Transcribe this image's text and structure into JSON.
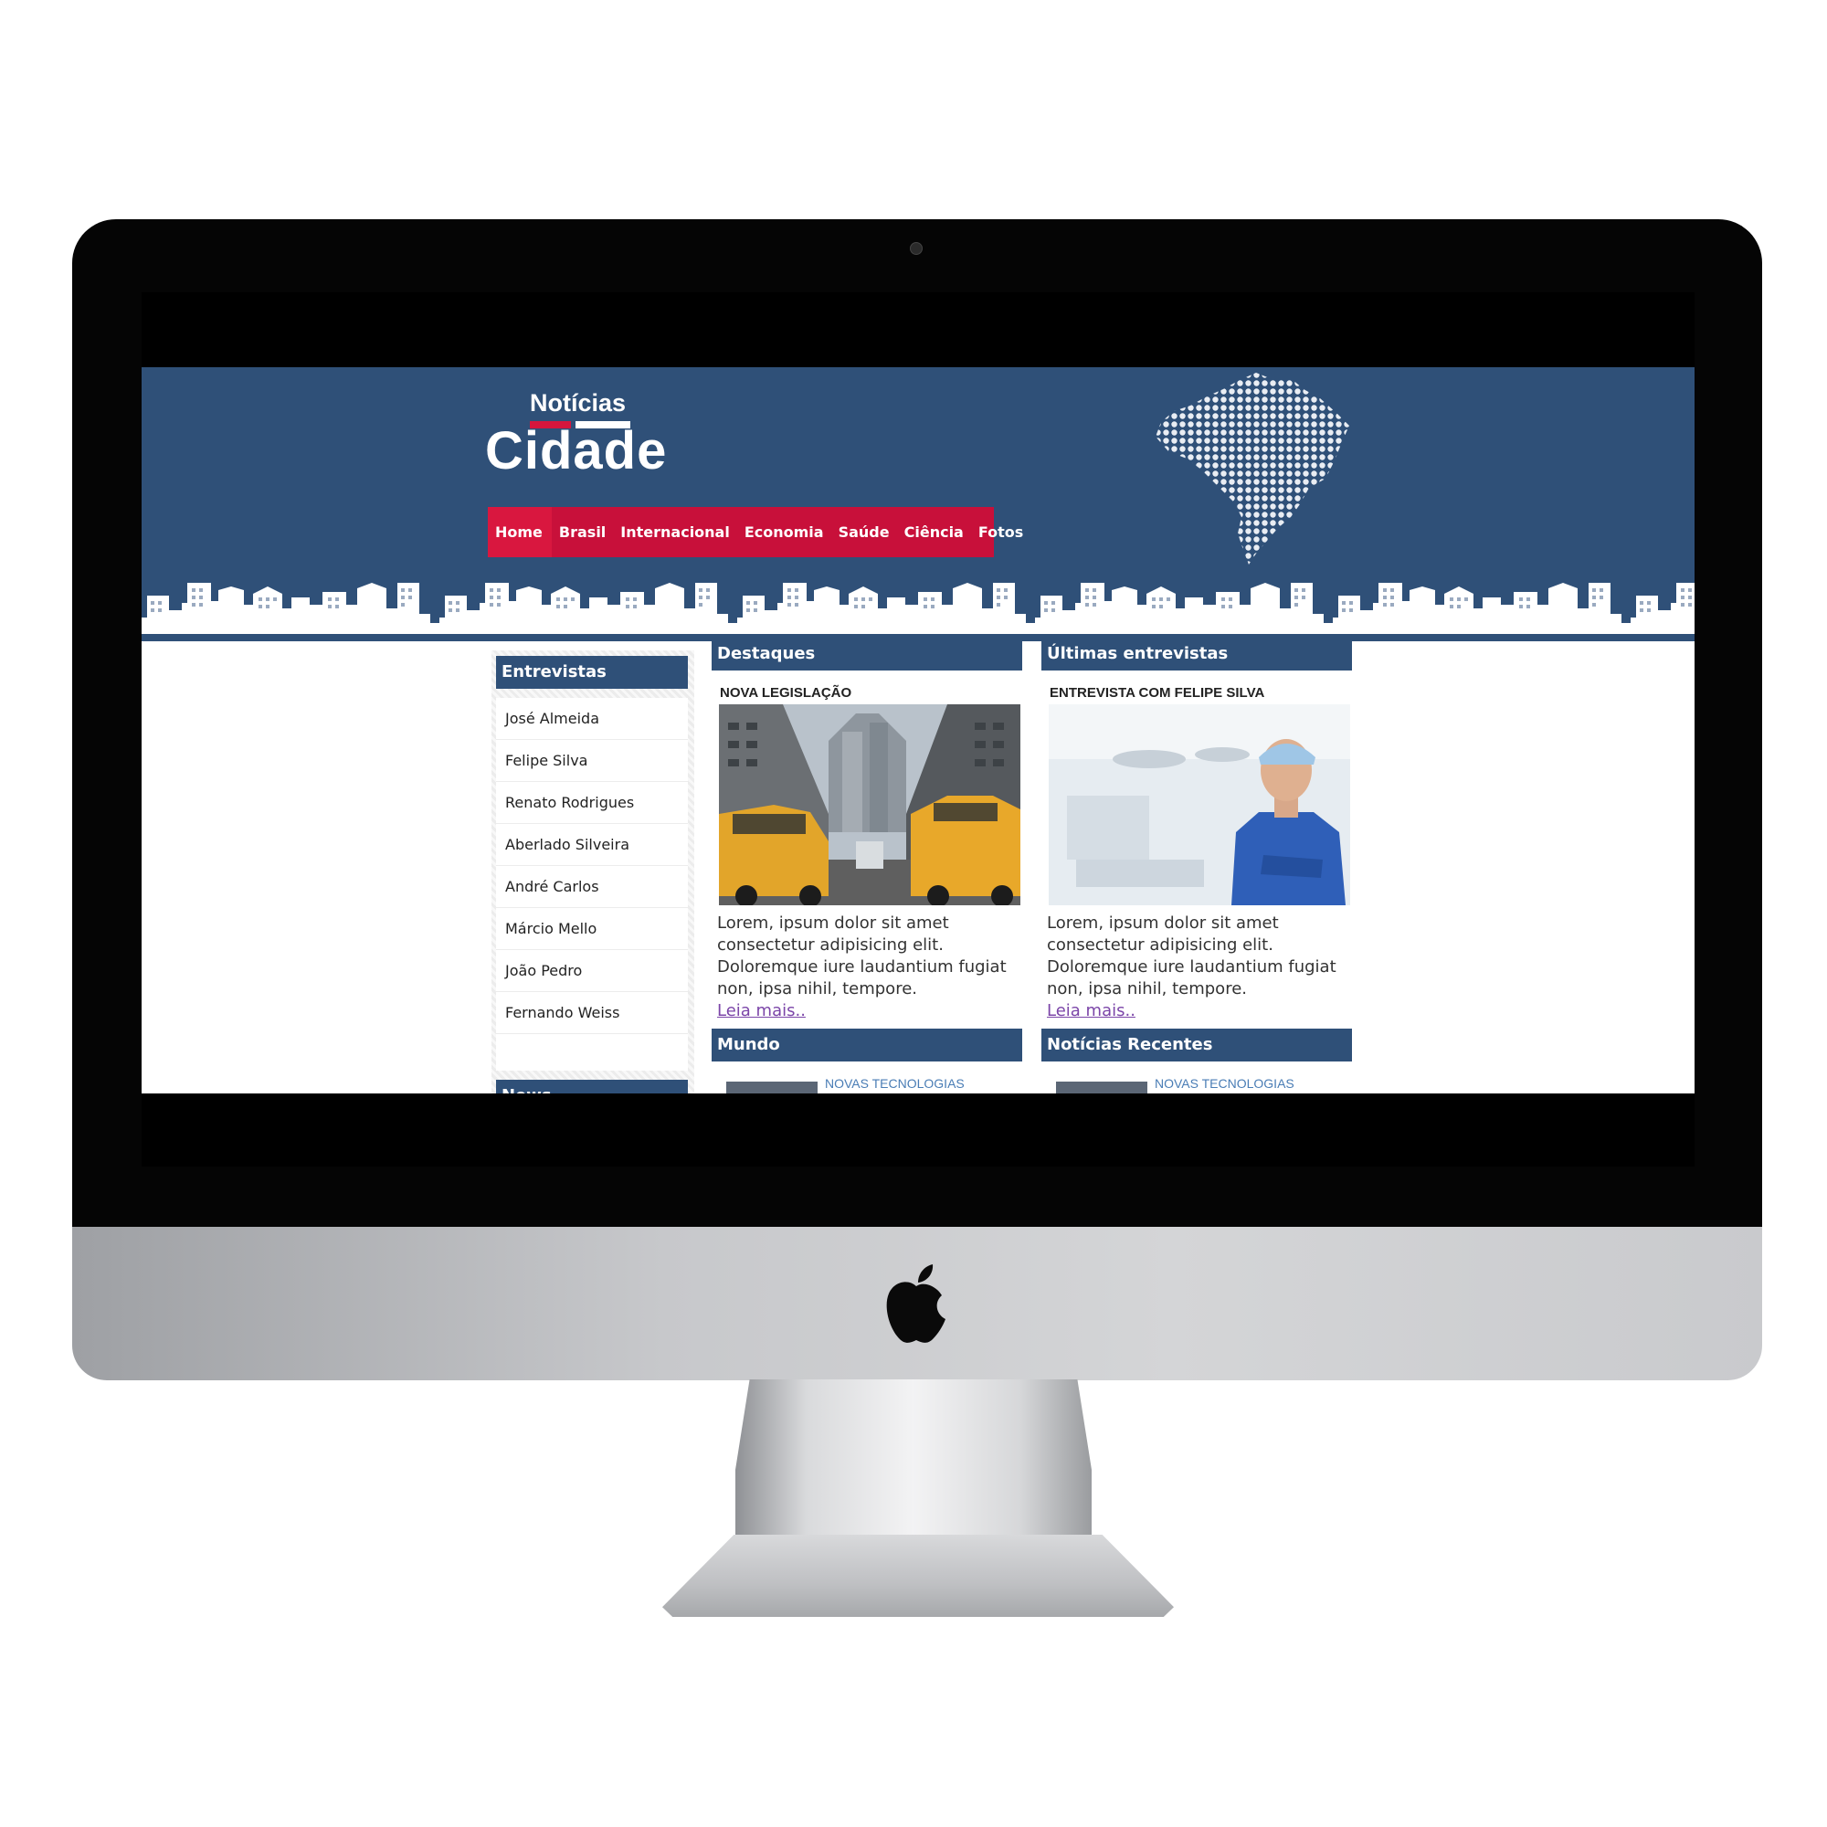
{
  "brand": {
    "top": "Notícias",
    "main": "Cidade"
  },
  "colors": {
    "header_blue": "#2f5078",
    "nav_red": "#c8103a",
    "link_purple": "#7b45a8"
  },
  "nav": {
    "items": [
      {
        "label": "Home"
      },
      {
        "label": "Brasil"
      },
      {
        "label": "Internacional"
      },
      {
        "label": "Economia"
      },
      {
        "label": "Saúde"
      },
      {
        "label": "Ciência"
      },
      {
        "label": "Fotos"
      }
    ],
    "active": "Home"
  },
  "sidebar": {
    "interviews_heading": "Entrevistas",
    "interviews": [
      {
        "name": "José Almeida"
      },
      {
        "name": "Felipe Silva"
      },
      {
        "name": "Renato Rodrigues"
      },
      {
        "name": "Aberlado Silveira"
      },
      {
        "name": "André Carlos"
      },
      {
        "name": "Márcio Mello"
      },
      {
        "name": "João Pedro"
      },
      {
        "name": "Fernando Weiss"
      }
    ],
    "news_heading": "News"
  },
  "featured": {
    "heading": "Destaques",
    "kicker": "NOVA LEGISLAÇÃO",
    "image": "city-street-taxis-photo",
    "text": "Lorem, ipsum dolor sit amet consectetur adipisicing elit. Doloremque iure laudantium fugiat non, ipsa nihil, tempore.",
    "link": "Leia mais.."
  },
  "latest_interviews": {
    "heading": "Últimas entrevistas",
    "kicker": "ENTREVISTA COM FELIPE SILVA",
    "image": "doctor-portrait-photo",
    "text": "Lorem, ipsum dolor sit amet consectetur adipisicing elit. Doloremque iure laudantium fugiat non, ipsa nihil, tempore.",
    "link": "Leia mais.."
  },
  "world": {
    "heading": "Mundo",
    "item_label": "NOVAS TECNOLOGIAS"
  },
  "recent": {
    "heading": "Notícias Recentes",
    "item_label": "NOVAS TECNOLOGIAS"
  }
}
